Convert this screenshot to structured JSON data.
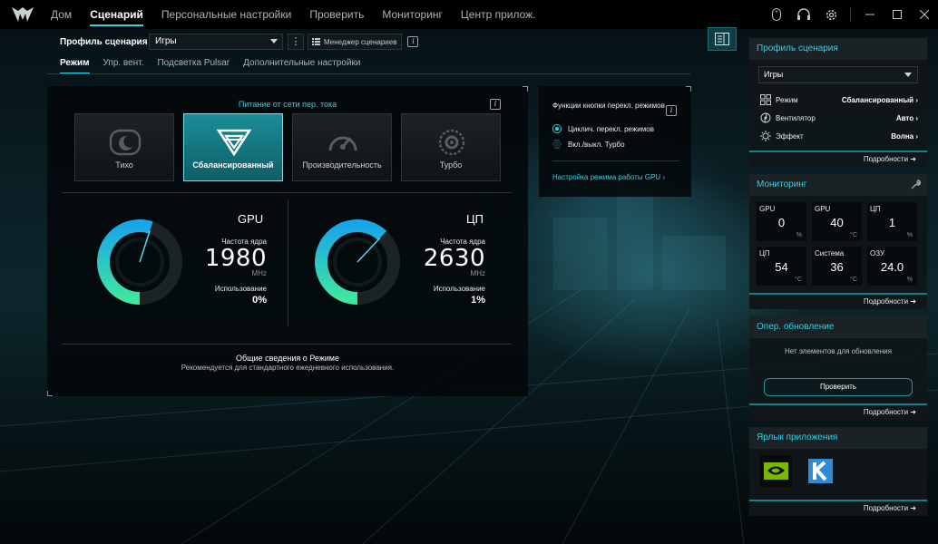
{
  "nav": {
    "items": [
      "Дом",
      "Сценарий",
      "Персональные настройки",
      "Проверить",
      "Мониторинг",
      "Центр прилож."
    ],
    "active": "Сценарий"
  },
  "window_icons": [
    "mouse-icon",
    "headset-icon",
    "gear-icon",
    "minimize-icon",
    "maximize-icon",
    "close-icon"
  ],
  "profile": {
    "label": "Профиль сценария",
    "selected": "Игры",
    "manager_label": "Менеджер сценариев"
  },
  "subtabs": [
    "Режим",
    "Упр. вент.",
    "Подсветка Pulsar",
    "Дополнительные настройки"
  ],
  "mode_panel": {
    "power_title": "Питание от сети пер. тока",
    "modes": [
      {
        "label": "Тихо",
        "icon": "moon-icon",
        "active": false
      },
      {
        "label": "Сбалансированный",
        "icon": "balanced-icon",
        "active": true
      },
      {
        "label": "Производительность",
        "icon": "speedometer-icon",
        "active": false
      },
      {
        "label": "Турбо",
        "icon": "turbo-icon",
        "active": false
      }
    ],
    "gpu": {
      "title": "GPU",
      "freq_label": "Частота ядра",
      "freq": "1980",
      "unit": "MHz",
      "usage_label": "Использование",
      "usage": "0%",
      "level": 0.55
    },
    "cpu": {
      "title": "ЦП",
      "freq_label": "Частота ядра",
      "freq": "2630",
      "unit": "MHz",
      "usage_label": "Использование",
      "usage": "1%",
      "level": 0.62
    },
    "summary_title": "Общие сведения о Режиме",
    "summary_text": "Рекомендуется для стандартного ежедневного использования."
  },
  "button_panel": {
    "title": "Функции кнопки перекл. режимов",
    "options": [
      {
        "label": "Циклич. перекл. режимов",
        "selected": true
      },
      {
        "label": "Вкл./выкл. Турбо",
        "selected": false
      }
    ],
    "link": "Настройка режима работы GPU ›"
  },
  "sidebar": {
    "profile": {
      "title": "Профиль сценария",
      "selected": "Игры",
      "rows": [
        {
          "label": "Режим",
          "value": "Сбалансированный ›",
          "icon": "grid-icon"
        },
        {
          "label": "Вентилятор",
          "value": "Авто ›",
          "icon": "fan-icon"
        },
        {
          "label": "Эффект",
          "value": "Волна ›",
          "icon": "sun-icon"
        }
      ],
      "more": "Подробности"
    },
    "monitoring": {
      "title": "Мониторинг",
      "cells": [
        {
          "label": "GPU",
          "value": "0",
          "unit": "%"
        },
        {
          "label": "GPU",
          "value": "40",
          "unit": "°C"
        },
        {
          "label": "ЦП",
          "value": "1",
          "unit": "%"
        },
        {
          "label": "ЦП",
          "value": "54",
          "unit": "°C"
        },
        {
          "label": "Система",
          "value": "36",
          "unit": "°C"
        },
        {
          "label": "ОЗУ",
          "value": "24.0",
          "unit": "%"
        }
      ],
      "more": "Подробности"
    },
    "update": {
      "title": "Опер. обновление",
      "empty_text": "Нет элементов для обновления",
      "check_label": "Проверить",
      "more": "Подробности"
    },
    "shortcuts": {
      "title": "Ярлык приложения",
      "apps": [
        "nvidia-icon",
        "k-app-icon"
      ],
      "more": "Подробности"
    }
  },
  "colors": {
    "accent": "#2ad4ea",
    "gauge_start": "#19a6e8",
    "gauge_end": "#3ee6a0"
  }
}
